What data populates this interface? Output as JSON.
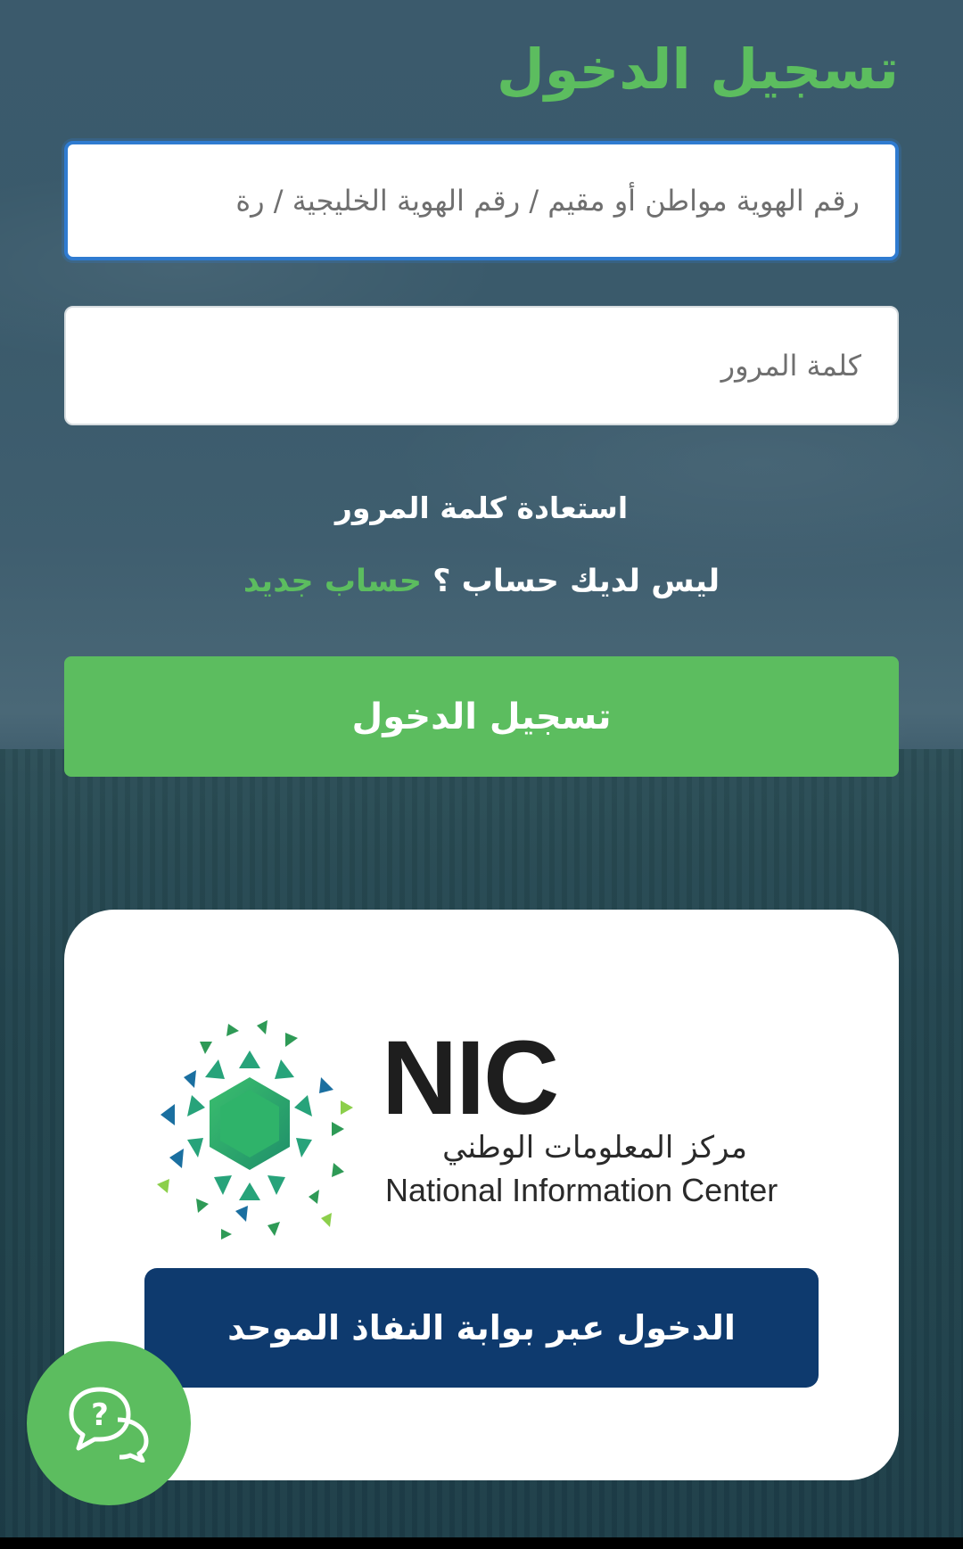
{
  "login": {
    "title": "تسجيل الدخول",
    "id_placeholder": "رقم الهوية مواطن أو مقيم / رقم الهوية الخليجية / رة",
    "password_placeholder": "كلمة المرور",
    "forgot_password": "استعادة كلمة المرور",
    "no_account_text": "ليس لديك حساب ؟",
    "new_account_link": "حساب جديد",
    "submit_label": "تسجيل الدخول"
  },
  "nic": {
    "abbr": "NIC",
    "name_ar": "مركز المعلومات الوطني",
    "name_en": "National Information Center",
    "nafath_button": "الدخول عبر بوابة النفاذ الموحد"
  },
  "help": {
    "icon": "help-chat-icon",
    "symbol": "?"
  },
  "colors": {
    "accent_green": "#5cbd5f",
    "nafath_blue": "#0e3a6e",
    "focus_blue": "#2f7bd0"
  }
}
